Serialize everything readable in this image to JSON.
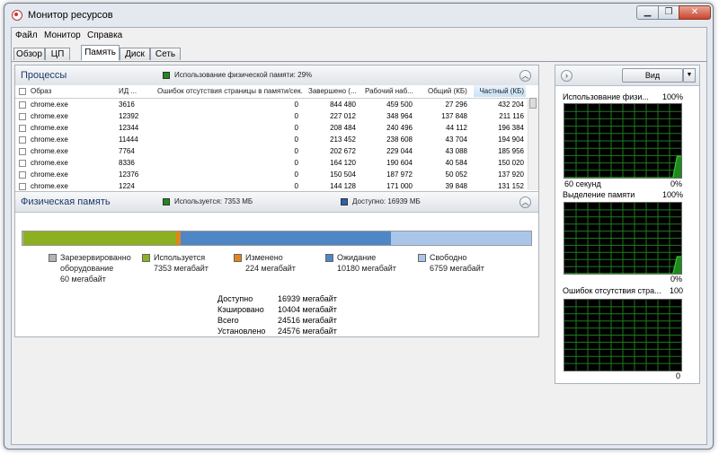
{
  "window": {
    "title": "Монитор ресурсов"
  },
  "menu": [
    "Файл",
    "Монитор",
    "Справка"
  ],
  "tabs": [
    "Обзор",
    "ЦП",
    "Память",
    "Диск",
    "Сеть"
  ],
  "active_tab": "Память",
  "processes": {
    "title": "Процессы",
    "usage_note": "Использование физической памяти: 29%",
    "columns": [
      "Образ",
      "ИД ...",
      "Ошибок отсутствия страницы в памяти/сек.",
      "Завершено (...",
      "Рабочий наб...",
      "Общий (КБ)",
      "Частный (КБ)"
    ],
    "rows": [
      {
        "image": "chrome.exe",
        "pid": "3616",
        "faults": "0",
        "commit": "844 480",
        "ws": "459 500",
        "shared": "27 296",
        "private": "432 204"
      },
      {
        "image": "chrome.exe",
        "pid": "12392",
        "faults": "0",
        "commit": "227 012",
        "ws": "348 964",
        "shared": "137 848",
        "private": "211 116"
      },
      {
        "image": "chrome.exe",
        "pid": "12344",
        "faults": "0",
        "commit": "208 484",
        "ws": "240 496",
        "shared": "44 112",
        "private": "196 384"
      },
      {
        "image": "chrome.exe",
        "pid": "11444",
        "faults": "0",
        "commit": "213 452",
        "ws": "238 608",
        "shared": "43 704",
        "private": "194 904"
      },
      {
        "image": "chrome.exe",
        "pid": "7764",
        "faults": "0",
        "commit": "202 672",
        "ws": "229 044",
        "shared": "43 088",
        "private": "185 956"
      },
      {
        "image": "chrome.exe",
        "pid": "8336",
        "faults": "0",
        "commit": "164 120",
        "ws": "190 604",
        "shared": "40 584",
        "private": "150 020"
      },
      {
        "image": "chrome.exe",
        "pid": "12376",
        "faults": "0",
        "commit": "150 504",
        "ws": "187 972",
        "shared": "50 052",
        "private": "137 920"
      },
      {
        "image": "chrome.exe",
        "pid": "1224",
        "faults": "0",
        "commit": "144 128",
        "ws": "171 000",
        "shared": "39 848",
        "private": "131 152"
      }
    ]
  },
  "physical": {
    "title": "Физическая память",
    "used_note": "Используется: 7353 МБ",
    "avail_note": "Доступно: 16939 МБ",
    "segments": [
      {
        "key": "reserved",
        "line1": "Зарезервированно",
        "line2": "оборудование",
        "line3": "60 мегабайт",
        "mb": 60,
        "color": "#b4b4b4"
      },
      {
        "key": "used",
        "line1": "Используется",
        "line2": "7353 мегабайт",
        "mb": 7353,
        "color": "#8cb021"
      },
      {
        "key": "modified",
        "line1": "Изменено",
        "line2": "224 мегабайт",
        "mb": 224,
        "color": "#e0861a"
      },
      {
        "key": "standby",
        "line1": "Ожидание",
        "line2": "10180 мегабайт",
        "mb": 10180,
        "color": "#4f86c6"
      },
      {
        "key": "free",
        "line1": "Свободно",
        "line2": "6759 мегабайт",
        "mb": 6759,
        "color": "#a9c6ea"
      }
    ],
    "stats": [
      {
        "label": "Доступно",
        "value": "16939 мегабайт"
      },
      {
        "label": "Кэшировано",
        "value": "10404 мегабайт"
      },
      {
        "label": "Всего",
        "value": "24516 мегабайт"
      },
      {
        "label": "Установлено",
        "value": "24576 мегабайт"
      }
    ]
  },
  "right_panel": {
    "view_label": "Вид",
    "graphs": [
      {
        "title": "Использование физи...",
        "max": "100%",
        "min": "0%",
        "footer": "60 секунд",
        "trend": [
          0,
          0,
          0,
          0,
          0,
          0,
          0,
          0,
          0,
          0,
          0,
          0,
          0,
          0,
          0,
          0,
          0,
          0,
          0,
          0,
          0,
          0,
          0,
          0,
          0,
          0,
          0,
          0.29,
          0.29
        ]
      },
      {
        "title": "Выделение памяти",
        "max": "100%",
        "min": "0%",
        "footer": "",
        "trend": [
          0,
          0,
          0,
          0,
          0,
          0,
          0,
          0,
          0,
          0,
          0,
          0,
          0,
          0,
          0,
          0,
          0,
          0,
          0,
          0,
          0,
          0,
          0,
          0,
          0,
          0,
          0,
          0.24,
          0.24
        ]
      },
      {
        "title": "Ошибок отсутствия стра...",
        "max": "100",
        "min": "0",
        "footer": "",
        "trend": []
      }
    ]
  },
  "colors": {
    "graph_grid": "#1f7a1f",
    "graph_line": "#33cc33",
    "graph_fill": "#1e8a1e",
    "used_box": "#1c8c1c",
    "avail_box": "#2d5fb3"
  }
}
